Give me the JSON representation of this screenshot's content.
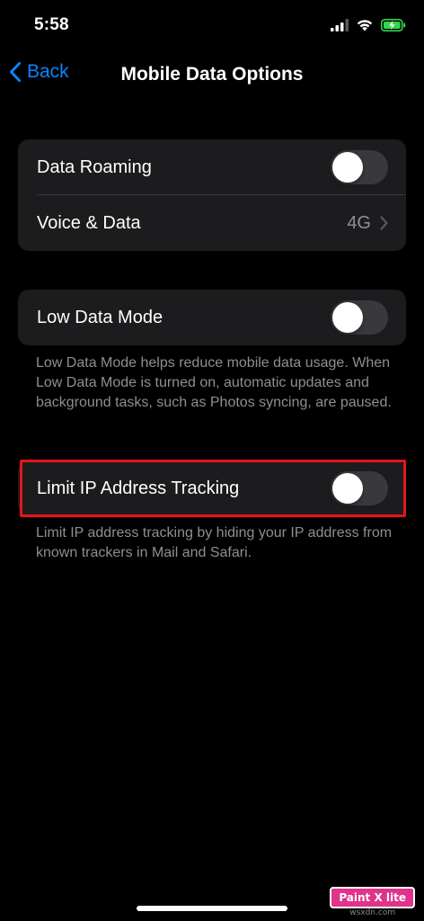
{
  "status_bar": {
    "time": "5:58",
    "icons": [
      "cellular-signal-icon",
      "wifi-icon",
      "battery-charging-icon"
    ]
  },
  "nav": {
    "back_label": "Back",
    "title": "Mobile Data Options"
  },
  "group1": {
    "rows": [
      {
        "label": "Data Roaming",
        "toggle_on": false
      },
      {
        "label": "Voice & Data",
        "value": "4G"
      }
    ]
  },
  "group2": {
    "rows": [
      {
        "label": "Low Data Mode",
        "toggle_on": false
      }
    ],
    "footnote": "Low Data Mode helps reduce mobile data usage. When Low Data Mode is turned on, automatic updates and background tasks, such as Photos syncing, are paused."
  },
  "group3": {
    "rows": [
      {
        "label": "Limit IP Address Tracking",
        "toggle_on": false
      }
    ],
    "footnote": "Limit IP address tracking by hiding your IP address from known trackers in Mail and Safari."
  },
  "watermark": {
    "logo_text": "Paint X lite",
    "site": "wsxdn.com"
  },
  "colors": {
    "background": "#000000",
    "cell_background": "#1c1c1e",
    "accent_blue": "#0a84ff",
    "toggle_off": "#39393d",
    "secondary_text": "#8e8e93",
    "highlight_red": "#e8141a",
    "battery_green": "#32d74b"
  }
}
